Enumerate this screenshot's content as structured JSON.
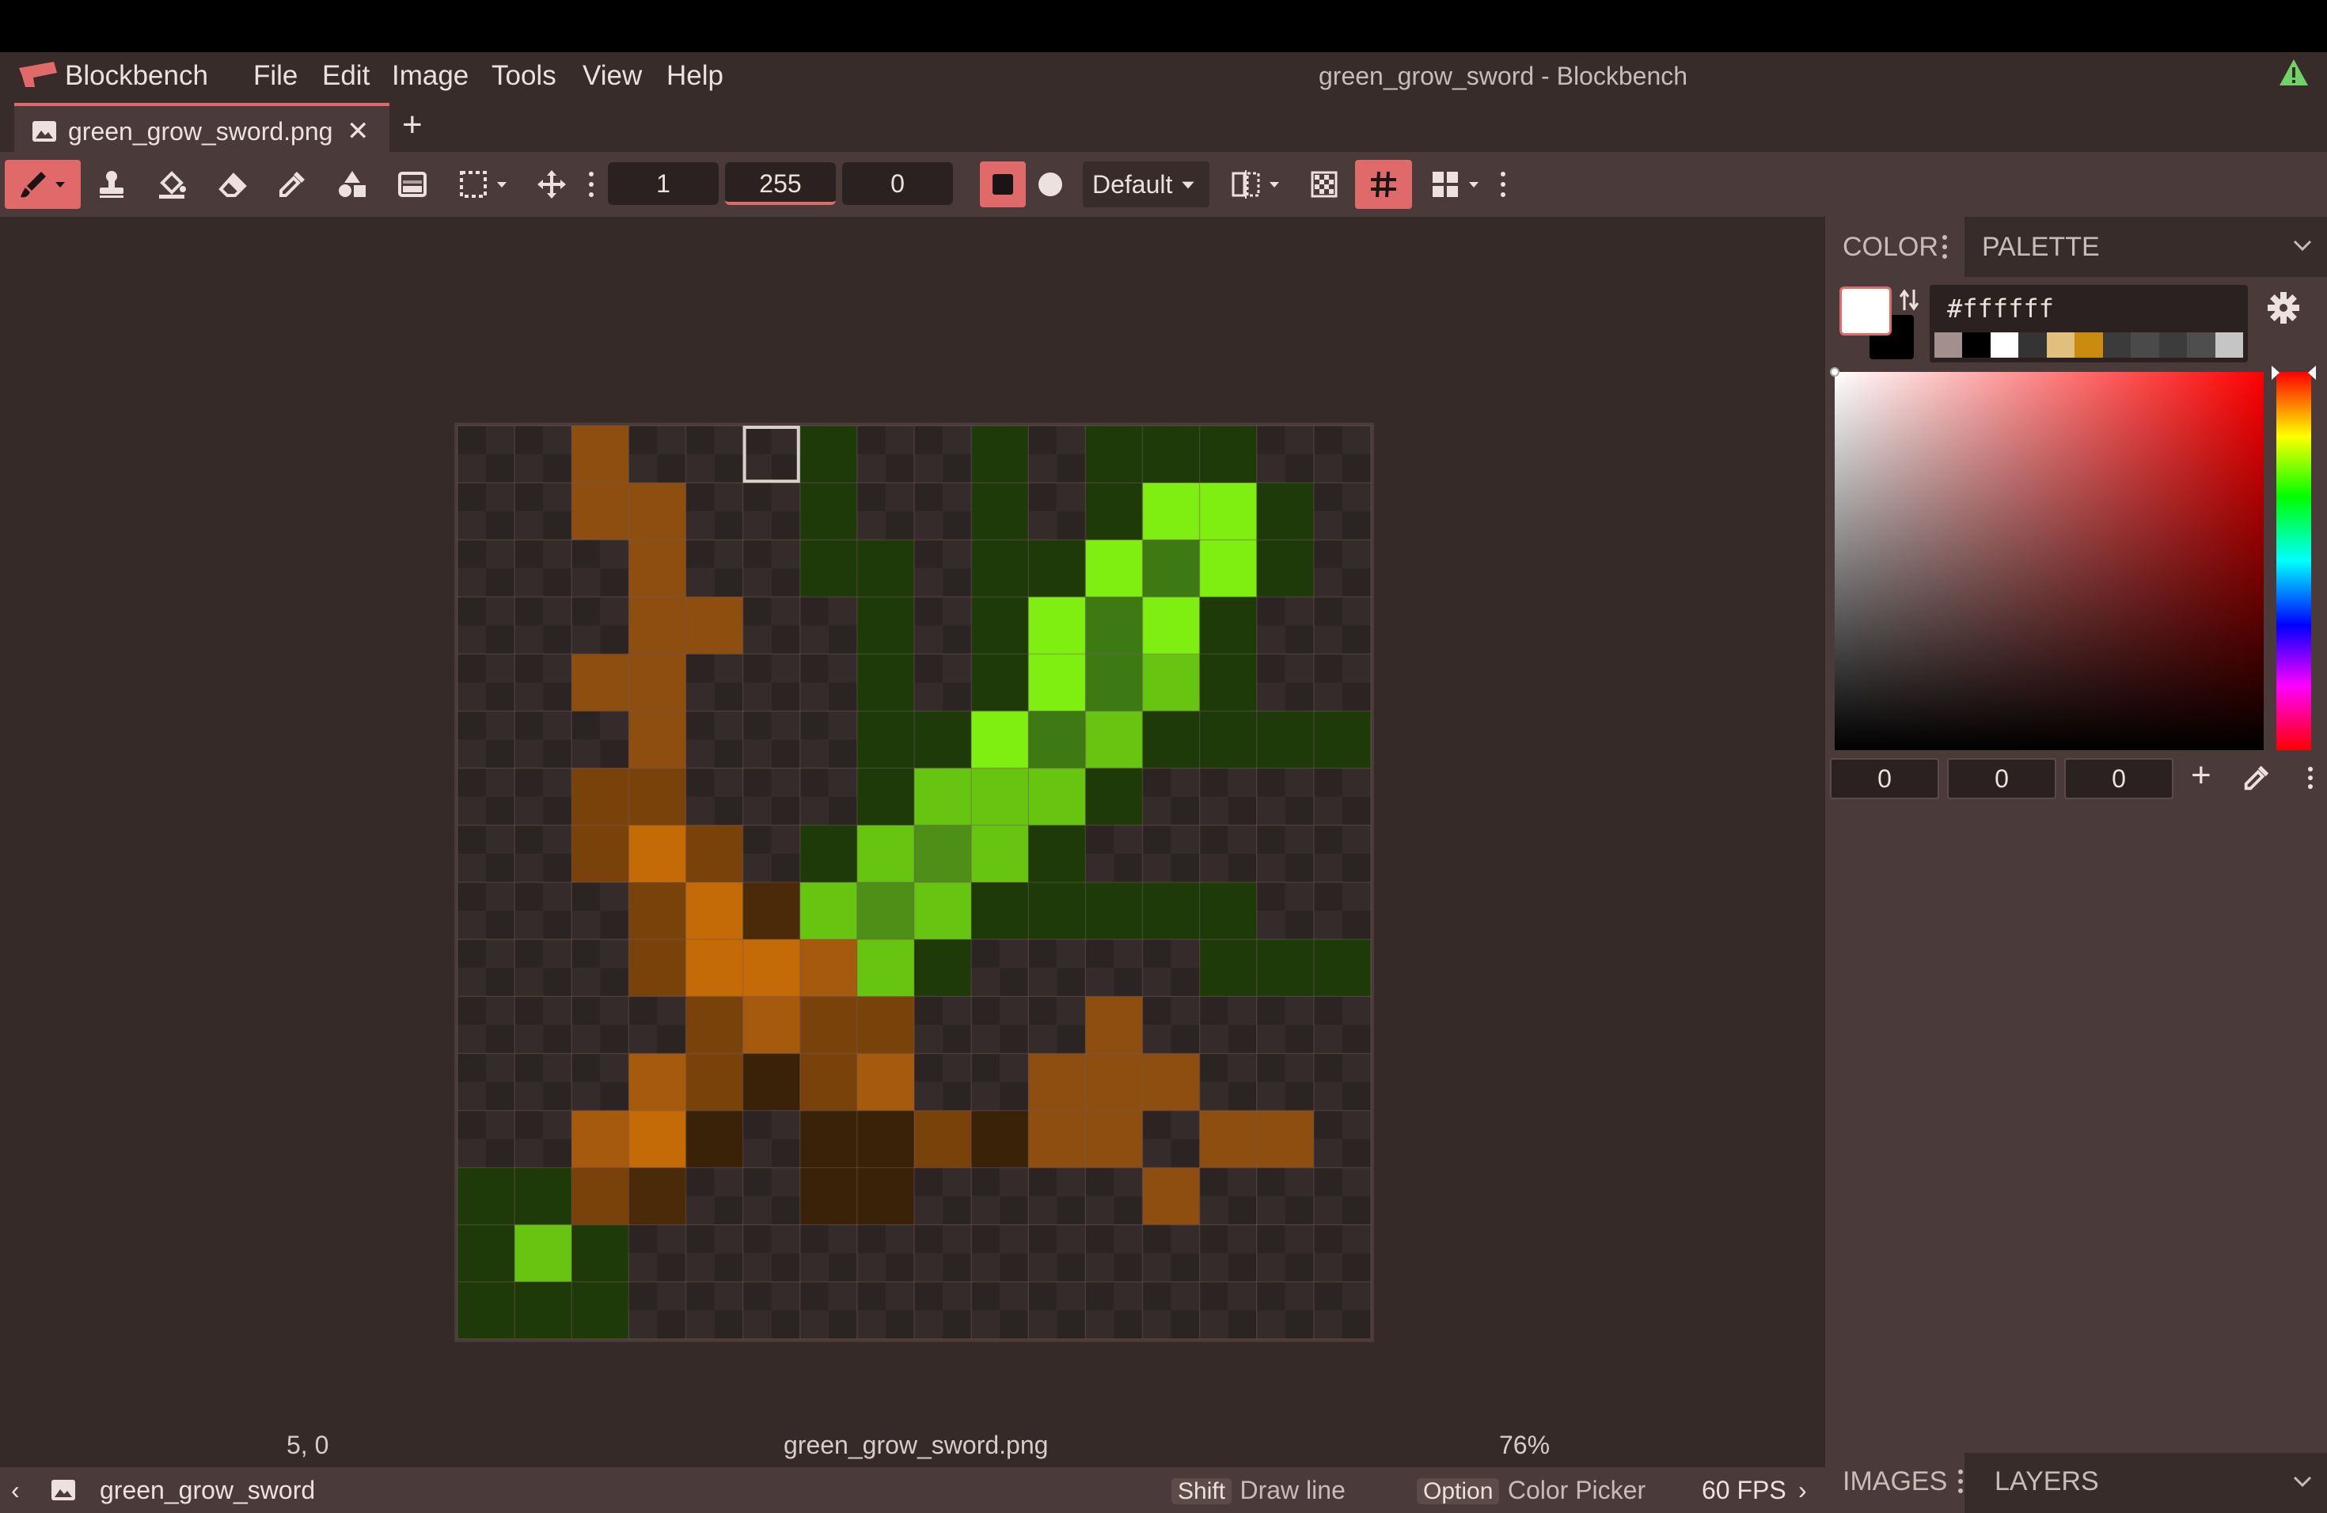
{
  "app": {
    "name": "Blockbench",
    "window_title": "green_grow_sword - Blockbench"
  },
  "menu": [
    "File",
    "Edit",
    "Image",
    "Tools",
    "View",
    "Help"
  ],
  "tabs": [
    {
      "label": "green_grow_sword.png",
      "active": true
    }
  ],
  "toolbar": {
    "brush_size": "1",
    "opacity": "255",
    "softness": "0",
    "blend_mode": "Default",
    "tools": [
      "brush-icon",
      "stamp-icon",
      "fill-icon",
      "eraser-icon",
      "color-picker-icon",
      "shapes-icon",
      "gradient-icon",
      "selection-icon",
      "move-icon",
      "square-shape-icon",
      "circle-shape-icon",
      "mirror-icon",
      "checkerboard-icon",
      "grid-icon",
      "layout-icon"
    ]
  },
  "canvas": {
    "filename": "green_grow_sword.png",
    "cursor_position": "5, 0",
    "zoom": "76%",
    "selected_pixel": [
      5,
      0
    ],
    "palette_key": {
      ".": null,
      "D": "#1e3a09",
      "G": "#2c5513",
      "N": "#3d7a13",
      "M": "#4e8f17",
      "L": "#67c411",
      "B": "#7fef12",
      "b": "#8d4e0f",
      "r": "#7a420b",
      "o": "#a55a0d",
      "O": "#c46a07",
      "d": "#4a2a08",
      "k": "#3a2208"
    },
    "rows": [
      "..b...D..D.DDD",
      "..bb..D..D.DBBD",
      "...b..DD.DDBNBD",
      "...bb..D.DBNBD.",
      "..bb...D.DBNLD.",
      "...b...DDBNLDDDD",
      "..rr...DLLLD....",
      "..rOr.DLMLD.....",
      "...rOdLMLDDDDD..",
      "...rOOoLD....DDD",
      "....rorr...b....",
      "...orkro..bbb...",
      "..oOk.kkrkbb.bb.",
      "DDrd..kk....b...",
      "DLD.............",
      "DDD............."
    ]
  },
  "color_panel": {
    "tabs": [
      "COLOR",
      "PALETTE"
    ],
    "hex": "#ffffff",
    "primary_color": "#ffffff",
    "secondary_color": "#000000",
    "recent_colors": [
      "#a38f8b",
      "#000000",
      "#ffffff",
      "#343434",
      "#e1c07d",
      "#cb8b0e",
      "#3b3b3b",
      "#4a4a4a",
      "#3c3c3c",
      "#4e4e4e",
      "#c5c5c5"
    ],
    "rgb": [
      "0",
      "0",
      "0"
    ]
  },
  "bottom_panel": {
    "tabs": [
      "IMAGES",
      "LAYERS"
    ]
  },
  "status": {
    "document": "green_grow_sword",
    "hints": [
      {
        "key": "Shift",
        "action": "Draw line"
      },
      {
        "key": "Option",
        "action": "Color Picker"
      }
    ],
    "fps": "60 FPS"
  },
  "colors": {
    "accent": "#e06a6a",
    "menubar": "#382c2b",
    "toolbar": "#4a3b3a",
    "workspace": "#362a29"
  }
}
